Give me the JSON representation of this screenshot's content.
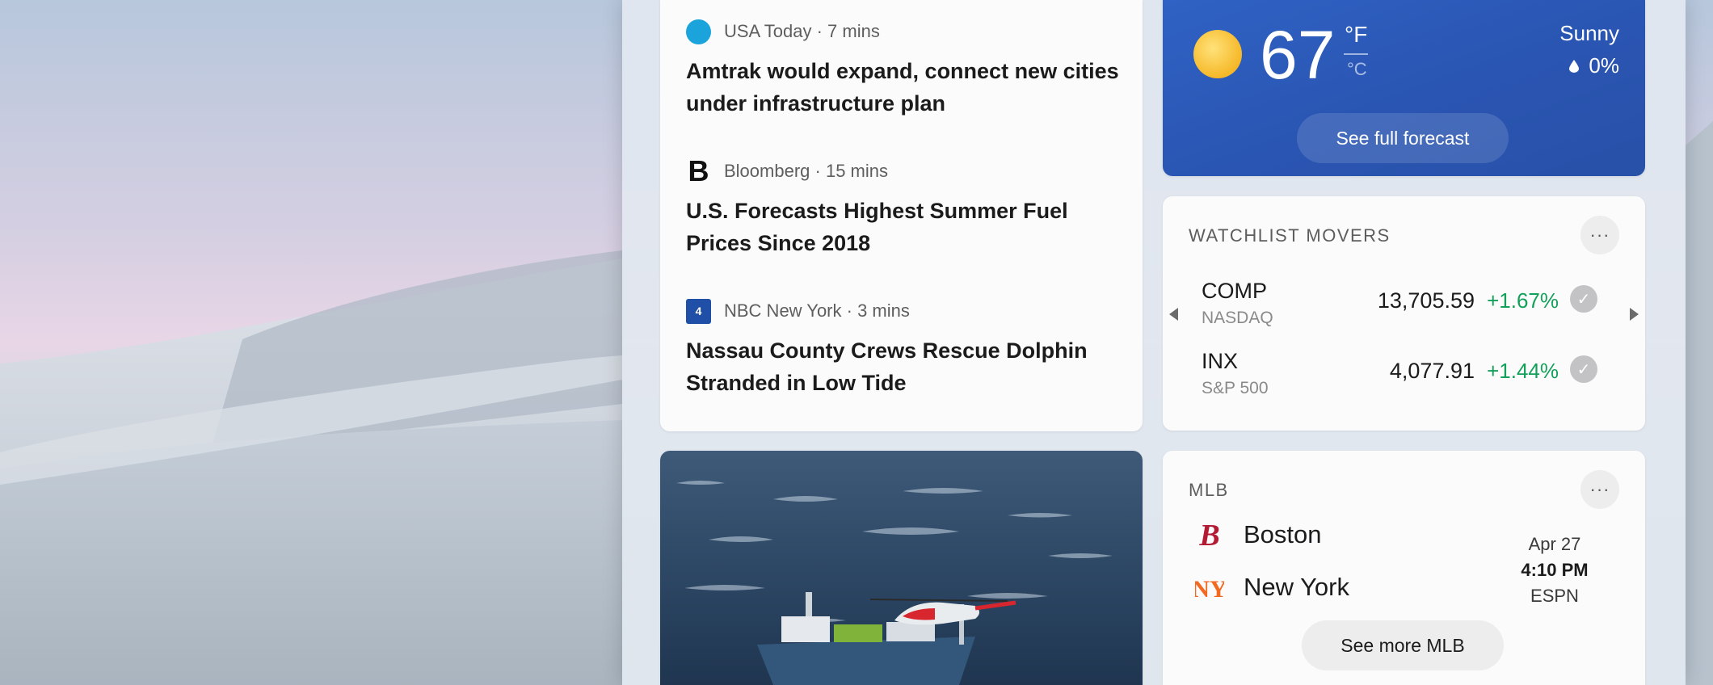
{
  "news": [
    {
      "source": "USA Today",
      "time": "7 mins",
      "headline": "Amtrak would expand, connect new cities under infrastructure plan",
      "logo": "usa-today-logo"
    },
    {
      "source": "Bloomberg",
      "time": "15 mins",
      "headline": "U.S. Forecasts Highest Summer Fuel Prices Since 2018",
      "logo": "bloomberg-logo"
    },
    {
      "source": "NBC New York",
      "time": "3 mins",
      "headline": "Nassau County Crews Rescue Dolphin Stranded in Low Tide",
      "logo": "nbc-logo"
    }
  ],
  "weather": {
    "temperature": "67",
    "unit_f": "°F",
    "unit_c": "°C",
    "condition": "Sunny",
    "precipitation": "0%",
    "forecast_label": "See full forecast"
  },
  "watchlist": {
    "title": "WATCHLIST MOVERS",
    "more": "···",
    "stocks": [
      {
        "symbol": "COMP",
        "exchange": "NASDAQ",
        "price": "13,705.59",
        "change": "+1.67%"
      },
      {
        "symbol": "INX",
        "exchange": "S&P 500",
        "price": "4,077.91",
        "change": "+1.44%"
      }
    ]
  },
  "mlb": {
    "title": "MLB",
    "more": "···",
    "teams": [
      {
        "name": "Boston",
        "logo": "b"
      },
      {
        "name": "New York",
        "logo": "NY"
      }
    ],
    "date": "Apr 27",
    "time": "4:10 PM",
    "network": "ESPN",
    "see_more": "See more MLB"
  },
  "colors": {
    "weather_bg": "#2a55b2",
    "positive": "#13a05a",
    "red_sox": "#b31b34",
    "mets": "#f26a21"
  }
}
